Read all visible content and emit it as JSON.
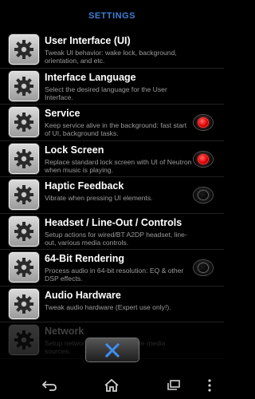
{
  "header": {
    "title": "SETTINGS"
  },
  "settings": [
    {
      "title": "User Interface (UI)",
      "description": "Tweak UI behavior: wake lock, background, orientation, and etc."
    },
    {
      "title": "Interface Language",
      "description": "Select the desired language for the User Interface."
    },
    {
      "title": "Service",
      "description": "Keep service alive in the background: fast start of UI, background tasks.",
      "toggle": "on"
    },
    {
      "title": "Lock Screen",
      "description": "Replace standard lock screen with UI of Neutron when music is playing.",
      "toggle": "on"
    },
    {
      "title": "Haptic Feedback",
      "description": "Vibrate when pressing UI elements.",
      "toggle": "off"
    },
    {
      "title": "Headset / Line-Out / Controls",
      "description": "Setup actions for wired/BT A2DP headset, line-out, various media controls."
    },
    {
      "title": "64-Bit Rendering",
      "description": "Process audio in 64-bit resolution: EQ & other DSP effects.",
      "toggle": "off"
    },
    {
      "title": "Audio Hardware",
      "description": "Tweak audio hardware (Expert use only!)."
    },
    {
      "title": "Network",
      "description": "Setup network access for remote media sources."
    }
  ],
  "icons": {
    "setting": "gear-icon",
    "close": "close-icon",
    "back": "back-icon",
    "home": "home-icon",
    "recents": "recent-apps-icon",
    "menu": "overflow-menu-icon"
  },
  "colors": {
    "title": "#3d7fd6",
    "toggle_on": "#e10000",
    "close_x": "#3f8ef0"
  }
}
